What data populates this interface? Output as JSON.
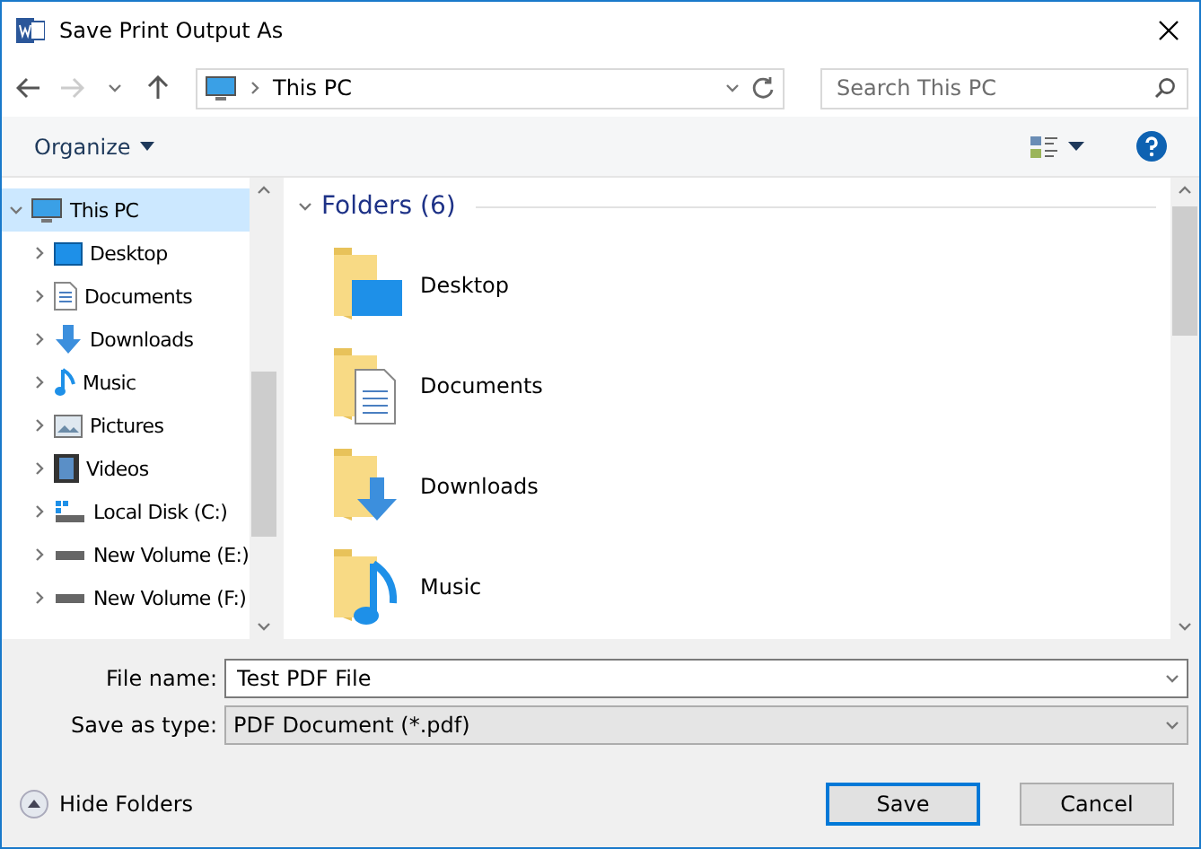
{
  "window": {
    "title": "Save Print Output As"
  },
  "address": {
    "location": "This PC",
    "search_placeholder": "Search This PC"
  },
  "toolbar": {
    "organize": "Organize"
  },
  "sidebar": {
    "items": [
      {
        "label": "This PC",
        "kind": "pc",
        "selected": true,
        "expanded": true,
        "children": [
          {
            "label": "Desktop",
            "kind": "desktop",
            "selected": false,
            "expanded": false
          },
          {
            "label": "Documents",
            "kind": "documents",
            "selected": false,
            "expanded": false
          },
          {
            "label": "Downloads",
            "kind": "downloads",
            "selected": false,
            "expanded": false
          },
          {
            "label": "Music",
            "kind": "music",
            "selected": false,
            "expanded": false
          },
          {
            "label": "Pictures",
            "kind": "pictures",
            "selected": false,
            "expanded": false
          },
          {
            "label": "Videos",
            "kind": "videos",
            "selected": false,
            "expanded": false
          },
          {
            "label": "Local Disk (C:)",
            "kind": "systemdisk",
            "selected": false,
            "expanded": false
          },
          {
            "label": "New Volume (E:)",
            "kind": "disk",
            "selected": false,
            "expanded": false
          },
          {
            "label": "New Volume (F:)",
            "kind": "disk",
            "selected": false,
            "expanded": false
          }
        ]
      }
    ]
  },
  "content": {
    "group_title": "Folders (6)",
    "group_expanded": true,
    "folders": [
      {
        "label": "Desktop",
        "kind": "desktop"
      },
      {
        "label": "Documents",
        "kind": "documents"
      },
      {
        "label": "Downloads",
        "kind": "downloads"
      },
      {
        "label": "Music",
        "kind": "music"
      }
    ]
  },
  "form": {
    "file_name_label": "File name:",
    "file_name": "Test PDF File",
    "type_label": "Save as type:",
    "type": "PDF Document (*.pdf)"
  },
  "footer": {
    "hide_folders": "Hide Folders",
    "buttons": [
      {
        "label": "Save",
        "kind": "primary"
      },
      {
        "label": "Cancel",
        "kind": "normal"
      }
    ]
  }
}
